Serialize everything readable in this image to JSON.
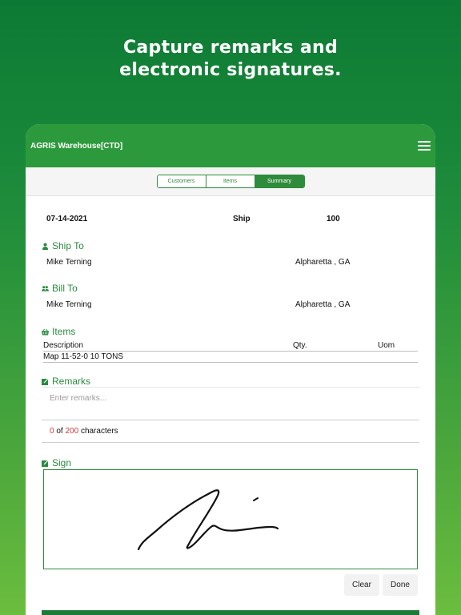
{
  "headline": {
    "line1": "Capture remarks and",
    "line2": "electronic signatures."
  },
  "appbar": {
    "title": "AGRIS Warehouse[CTD]",
    "menu_icon": "hamburger-menu-icon"
  },
  "tabs": [
    {
      "label": "Customers",
      "active": false
    },
    {
      "label": "Items",
      "active": false
    },
    {
      "label": "Summary",
      "active": true
    }
  ],
  "summary": {
    "date": "07-14-2021",
    "type": "Ship",
    "number": "100"
  },
  "ship_to": {
    "heading": "Ship To",
    "icon": "person-icon",
    "name": "Mike Terning",
    "location": "Alpharetta , GA"
  },
  "bill_to": {
    "heading": "Bill To",
    "icon": "people-icon",
    "name": "Mike Terning",
    "location": "Alpharetta , GA"
  },
  "items": {
    "heading": "Items",
    "icon": "basket-icon",
    "columns": [
      "Description",
      "Qty.",
      "Uom"
    ],
    "rows": [
      {
        "description": "Map 11-52-0 10 TONS",
        "qty": "",
        "uom": ""
      }
    ]
  },
  "remarks": {
    "heading": "Remarks",
    "icon": "edit-icon",
    "placeholder": "Enter remarks...",
    "count": "0",
    "of_text": "of",
    "max": "200",
    "suffix": "characters"
  },
  "sign": {
    "heading": "Sign",
    "icon": "edit-icon",
    "clear_label": "Clear",
    "done_label": "Done"
  },
  "colors": {
    "primary": "#2c9a3c",
    "accent_red": "#d9383a"
  }
}
